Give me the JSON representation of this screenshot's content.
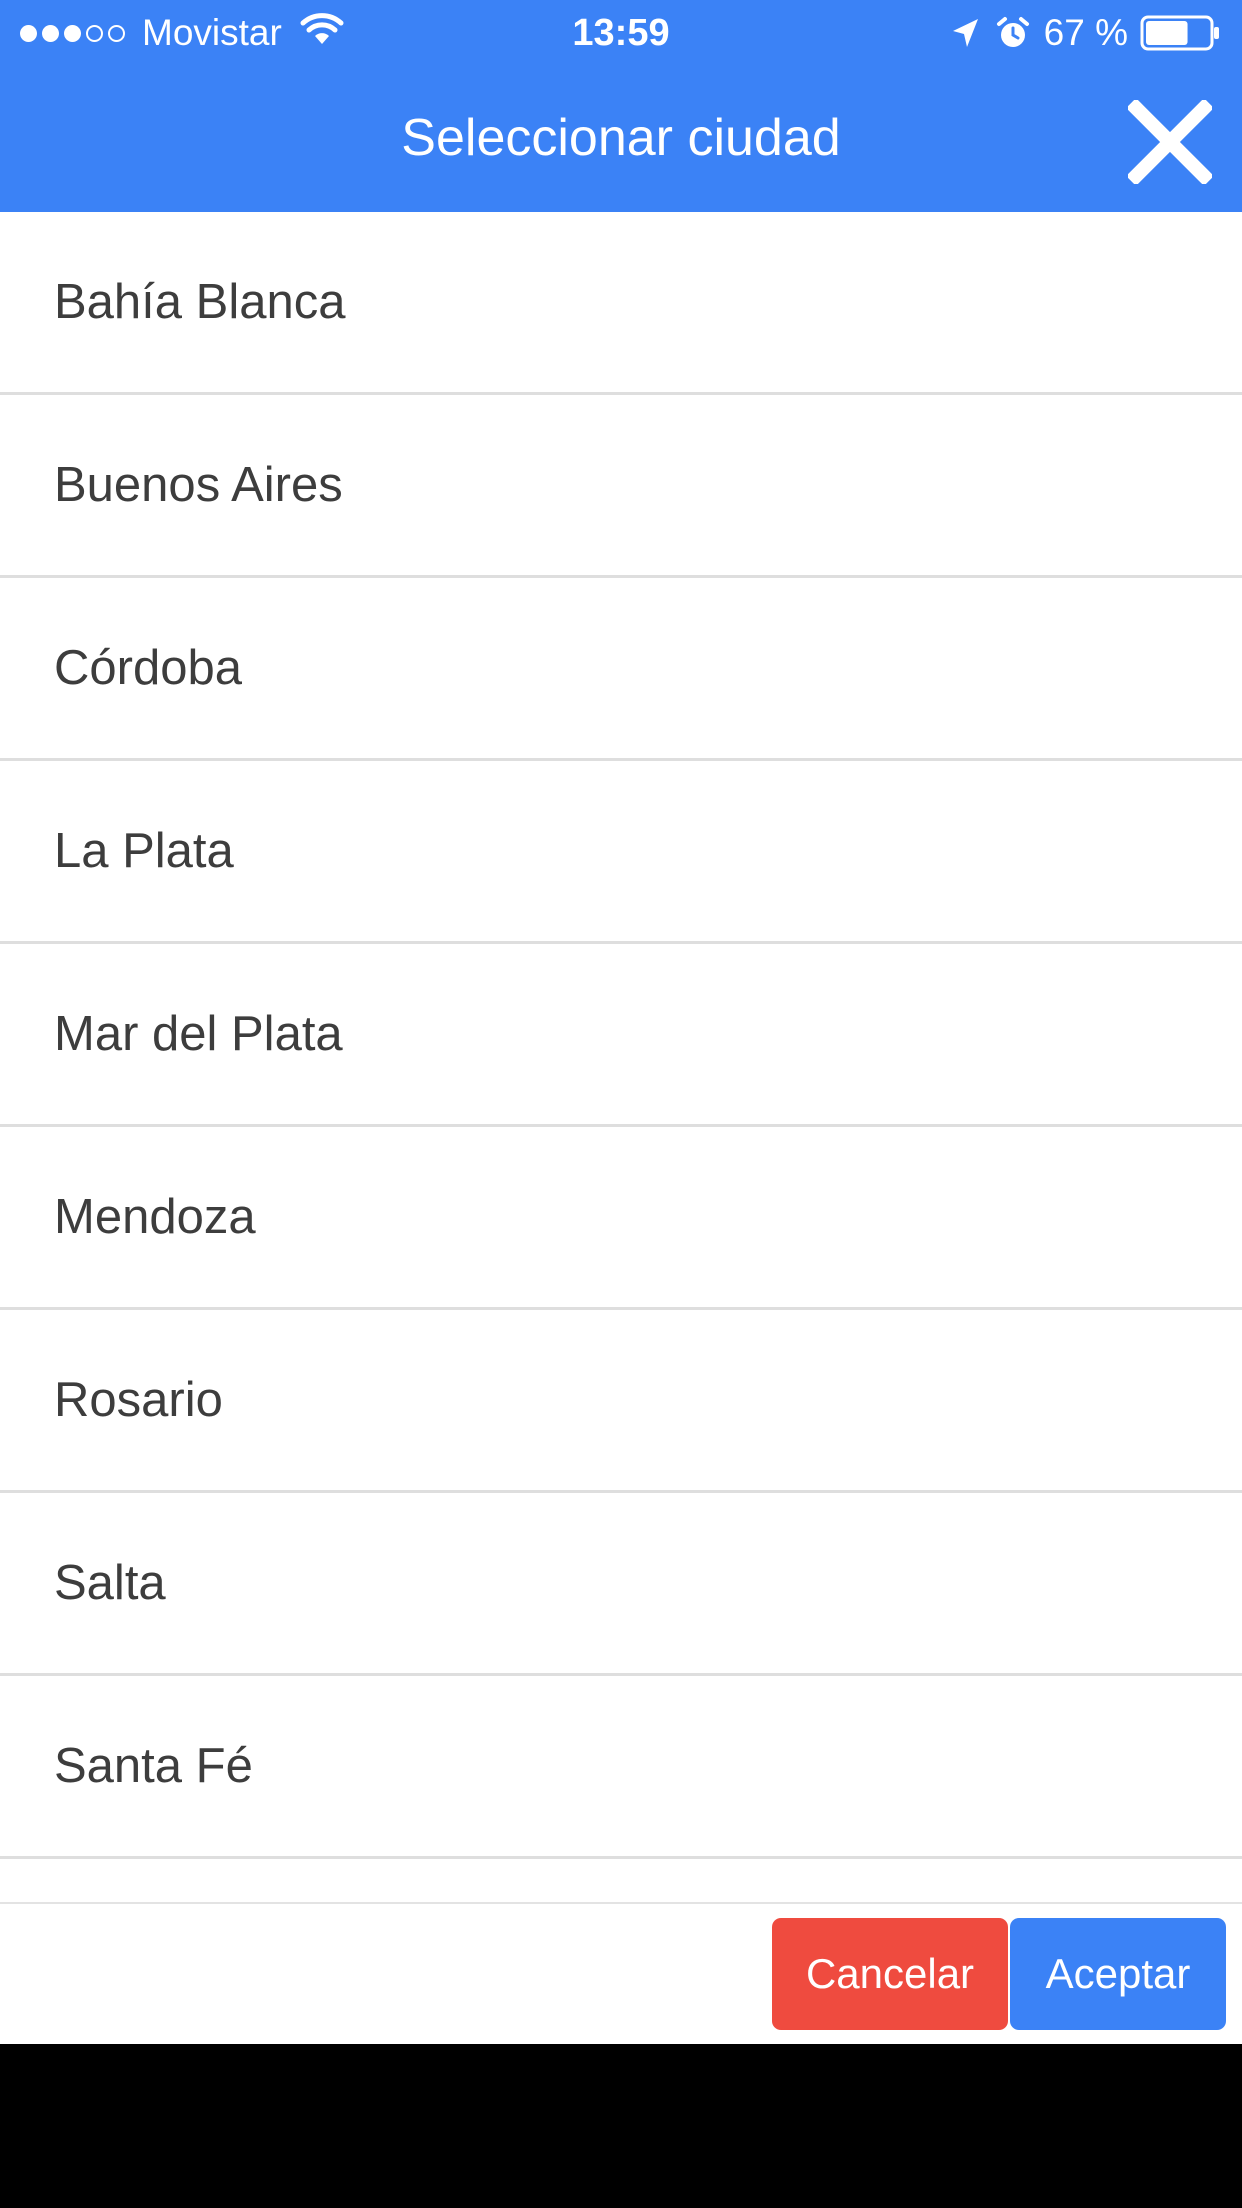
{
  "status_bar": {
    "carrier": "Movistar",
    "time": "13:59",
    "battery": "67 %",
    "signal_bars_filled": 3,
    "signal_bars_total": 5,
    "battery_level": 0.67
  },
  "header": {
    "title": "Seleccionar ciudad",
    "close_icon": "close-icon"
  },
  "cities": [
    "Bahía Blanca",
    "Buenos Aires",
    "Córdoba",
    "La Plata",
    "Mar del Plata",
    "Mendoza",
    "Rosario",
    "Salta",
    "Santa Fé"
  ],
  "footer": {
    "cancel_label": "Cancelar",
    "accept_label": "Aceptar"
  },
  "colors": {
    "primary": "#3b82f6",
    "danger": "#ef4b3f",
    "text": "#3d3d3d",
    "divider": "#dedede"
  }
}
